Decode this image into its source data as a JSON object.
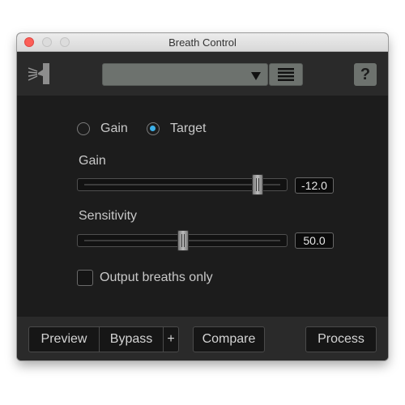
{
  "window": {
    "title": "Breath Control"
  },
  "toolbar": {
    "logo_icon": "breath-control-icon",
    "preset_value": "",
    "menu_icon": "list-menu-icon",
    "help_label": "?"
  },
  "mode": {
    "options": [
      {
        "label": "Gain",
        "selected": false
      },
      {
        "label": "Target",
        "selected": true
      }
    ]
  },
  "gain": {
    "label": "Gain",
    "value": "-12.0"
  },
  "sensitivity": {
    "label": "Sensitivity",
    "value": "50.0"
  },
  "output_breaths_only": {
    "label": "Output breaths only",
    "checked": false
  },
  "buttons": {
    "preview": "Preview",
    "bypass": "Bypass",
    "plus": "+",
    "compare": "Compare",
    "process": "Process"
  },
  "colors": {
    "accent": "#3cb0e8",
    "close": "#fc5f57",
    "panel": "#1c1c1c"
  }
}
